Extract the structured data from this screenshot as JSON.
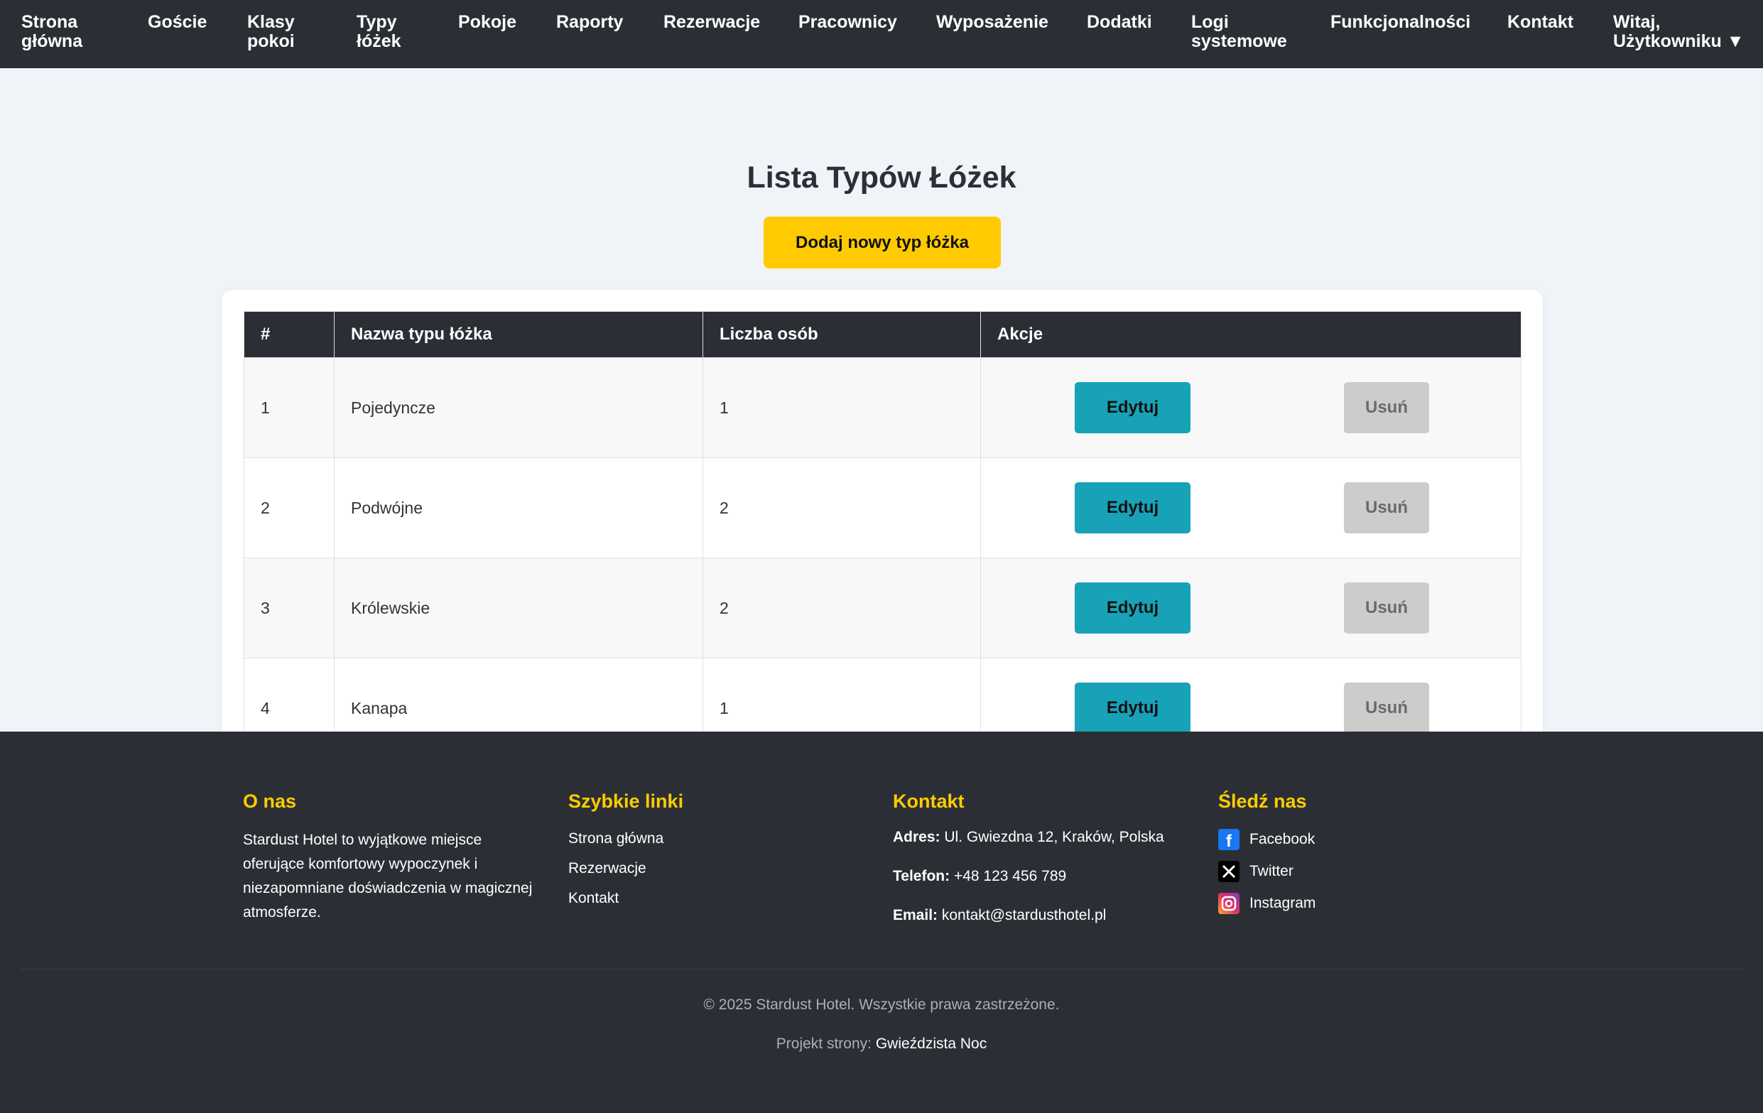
{
  "nav": {
    "items": [
      {
        "label": "Strona główna"
      },
      {
        "label": "Goście"
      },
      {
        "label": "Klasy pokoi"
      },
      {
        "label": "Typy łóżek"
      },
      {
        "label": "Pokoje"
      },
      {
        "label": "Raporty"
      },
      {
        "label": "Rezerwacje"
      },
      {
        "label": "Pracownicy"
      },
      {
        "label": "Wyposażenie"
      },
      {
        "label": "Dodatki"
      },
      {
        "label": "Logi systemowe"
      },
      {
        "label": "Funkcjonalności"
      },
      {
        "label": "Kontakt"
      }
    ],
    "user_menu": "Witaj, Użytkowniku ▼"
  },
  "main": {
    "title": "Lista Typów Łóżek",
    "add_button": "Dodaj nowy typ łóżka",
    "table": {
      "headers": [
        "#",
        "Nazwa typu łóżka",
        "Liczba osób",
        "Akcje"
      ],
      "rows": [
        {
          "id": "1",
          "name": "Pojedyncze",
          "capacity": "1"
        },
        {
          "id": "2",
          "name": "Podwójne",
          "capacity": "2"
        },
        {
          "id": "3",
          "name": "Królewskie",
          "capacity": "2"
        },
        {
          "id": "4",
          "name": "Kanapa",
          "capacity": "1"
        }
      ],
      "edit_label": "Edytuj",
      "delete_label": "Usuń"
    }
  },
  "footer": {
    "about": {
      "title": "O nas",
      "text": "Stardust Hotel to wyjątkowe miejsce oferujące komfortowy wypoczynek i niezapomniane doświadczenia w magicznej atmosferze."
    },
    "links": {
      "title": "Szybkie linki",
      "items": [
        "Strona główna",
        "Rezerwacje",
        "Kontakt"
      ]
    },
    "contact": {
      "title": "Kontakt",
      "address_label": "Adres:",
      "address": "Ul. Gwiezdna 12, Kraków, Polska",
      "phone_label": "Telefon:",
      "phone": "+48 123 456 789",
      "email_label": "Email:",
      "email": "kontakt@stardusthotel.pl"
    },
    "social": {
      "title": "Śledź nas",
      "items": [
        {
          "label": "Facebook",
          "icon": "facebook-icon"
        },
        {
          "label": "Twitter",
          "icon": "x-twitter-icon"
        },
        {
          "label": "Instagram",
          "icon": "instagram-icon"
        }
      ]
    },
    "copyright": "© 2025 Stardust Hotel. Wszystkie prawa zastrzeżone.",
    "credit_prefix": "Projekt strony:",
    "credit_name": "Gwieździsta Noc"
  },
  "colors": {
    "accent": "#ffcb00",
    "nav_bg": "#2b2f35",
    "edit_button": "#17a2b8",
    "delete_button": "#cccccc"
  }
}
